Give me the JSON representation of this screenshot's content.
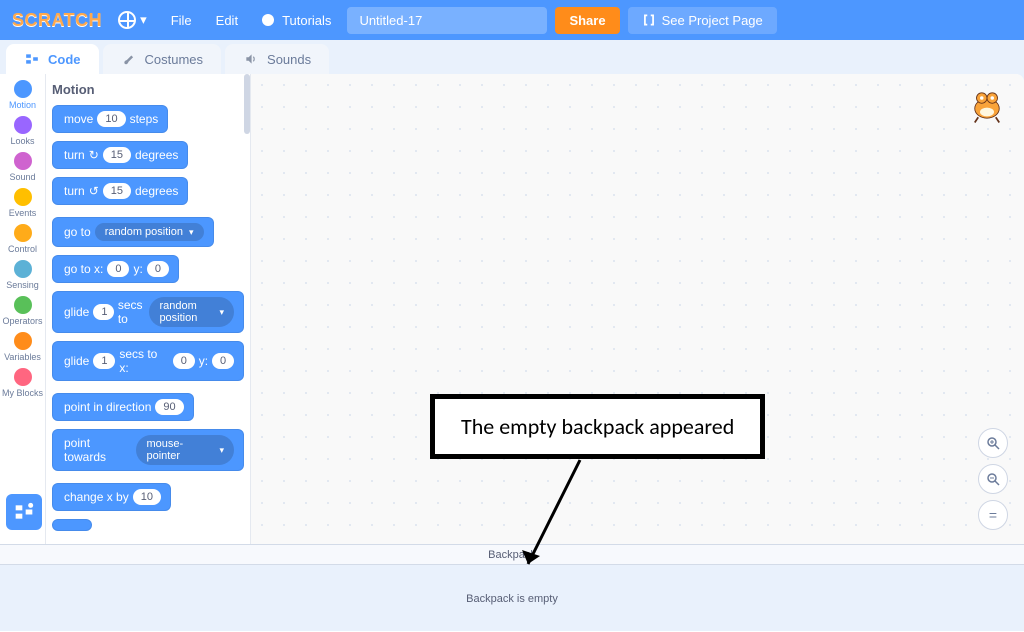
{
  "menu": {
    "logo": "SCRATCH",
    "file": "File",
    "edit": "Edit",
    "tutorials": "Tutorials",
    "title": "Untitled-17",
    "share": "Share",
    "see_project": "See Project Page"
  },
  "tabs": {
    "code": "Code",
    "costumes": "Costumes",
    "sounds": "Sounds"
  },
  "categories": [
    {
      "name": "Motion",
      "color": "#4c97ff"
    },
    {
      "name": "Looks",
      "color": "#9966ff"
    },
    {
      "name": "Sound",
      "color": "#cf63cf"
    },
    {
      "name": "Events",
      "color": "#ffbf00"
    },
    {
      "name": "Control",
      "color": "#ffab19"
    },
    {
      "name": "Sensing",
      "color": "#5cb1d6"
    },
    {
      "name": "Operators",
      "color": "#59c059"
    },
    {
      "name": "Variables",
      "color": "#ff8c1a"
    },
    {
      "name": "My Blocks",
      "color": "#ff6680"
    }
  ],
  "palette": {
    "title": "Motion",
    "blocks": {
      "move_a": "move",
      "move_val": "10",
      "move_b": "steps",
      "turncw_a": "turn",
      "turncw_val": "15",
      "turncw_b": "degrees",
      "turnccw_a": "turn",
      "turnccw_val": "15",
      "turnccw_b": "degrees",
      "goto_a": "go to",
      "goto_target": "random position",
      "gotoxy_a": "go to x:",
      "gotoxy_x": "0",
      "gotoxy_b": "y:",
      "gotoxy_y": "0",
      "glide_a": "glide",
      "glide_secs": "1",
      "glide_b": "secs to",
      "glide_target": "random position",
      "glidexy_a": "glide",
      "glidexy_secs": "1",
      "glidexy_b": "secs to x:",
      "glidexy_x": "0",
      "glidexy_c": "y:",
      "glidexy_y": "0",
      "point_a": "point in direction",
      "point_val": "90",
      "pointto_a": "point towards",
      "pointto_target": "mouse-pointer",
      "changex_a": "change x by",
      "changex_val": "10"
    }
  },
  "backpack": {
    "header": "Backpack",
    "empty_text": "Backpack is empty"
  },
  "callout": "The empty backpack appeared",
  "zoom": {
    "in": "+",
    "out": "−",
    "reset": "="
  }
}
